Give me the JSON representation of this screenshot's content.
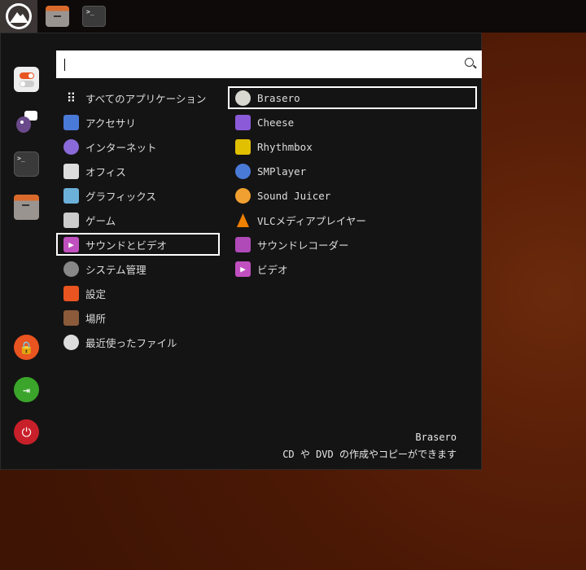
{
  "taskbar": {
    "icons": [
      "start-menu-icon",
      "file-manager-icon",
      "terminal-icon"
    ],
    "terminal_glyph": ">_"
  },
  "search": {
    "value": "",
    "placeholder": ""
  },
  "sidebar": [
    "settings",
    "pidgin",
    "terminal",
    "files",
    "lock",
    "logout",
    "shutdown"
  ],
  "categories": [
    {
      "label": "すべてのアプリケーション",
      "icon": "grid-icon"
    },
    {
      "label": "アクセサリ",
      "icon": "accessories-icon"
    },
    {
      "label": "インターネット",
      "icon": "internet-icon"
    },
    {
      "label": "オフィス",
      "icon": "office-icon"
    },
    {
      "label": "グラフィックス",
      "icon": "graphics-icon"
    },
    {
      "label": "ゲーム",
      "icon": "games-icon"
    },
    {
      "label": "サウンドとビデオ",
      "icon": "multimedia-icon",
      "selected": true
    },
    {
      "label": "システム管理",
      "icon": "system-icon"
    },
    {
      "label": "設定",
      "icon": "settings-icon"
    },
    {
      "label": "場所",
      "icon": "places-icon"
    },
    {
      "label": "最近使ったファイル",
      "icon": "recent-icon"
    }
  ],
  "apps": [
    {
      "label": "Brasero",
      "icon": "brasero-icon",
      "color": "#d8d8d0",
      "selected": true
    },
    {
      "label": "Cheese",
      "icon": "cheese-icon",
      "color": "#8a5ad8"
    },
    {
      "label": "Rhythmbox",
      "icon": "rhythmbox-icon",
      "color": "#e0c000"
    },
    {
      "label": "SMPlayer",
      "icon": "smplayer-icon",
      "color": "#4a7ad8"
    },
    {
      "label": "Sound Juicer",
      "icon": "sound-juicer-icon",
      "color": "#f0a030"
    },
    {
      "label": "VLCメディアプレイヤー",
      "icon": "vlc-icon",
      "color": "#f08000"
    },
    {
      "label": "サウンドレコーダー",
      "icon": "sound-recorder-icon",
      "color": "#b04ab8"
    },
    {
      "label": "ビデオ",
      "icon": "video-icon",
      "color": "#c050c0"
    }
  ],
  "description": {
    "title": "Brasero",
    "text": "CD や DVD の作成やコピーができます"
  }
}
